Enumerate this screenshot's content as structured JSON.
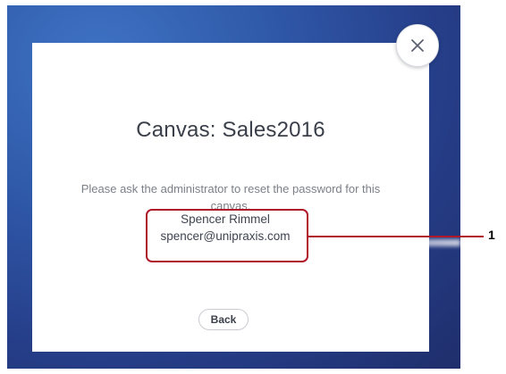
{
  "dialog": {
    "title": "Canvas: Sales2016",
    "message": "Please ask the administrator to reset the password for this canvas.",
    "contact_name": "Spencer Rimmel",
    "contact_email": "spencer@unipraxis.com",
    "back_label": "Back"
  },
  "annotation": {
    "callout_number": "1",
    "color": "#b0182a"
  },
  "icons": {
    "close": "close-icon"
  },
  "colors": {
    "backdrop": "#2f58a8",
    "dialog": "#ffffff"
  }
}
